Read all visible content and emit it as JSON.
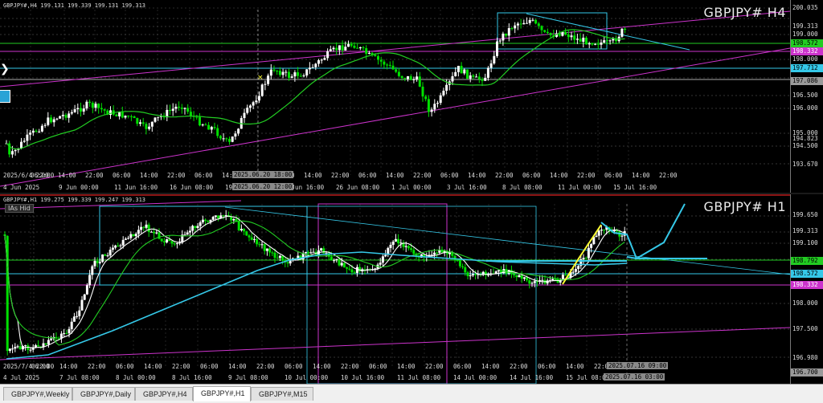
{
  "top": {
    "header": "GBPJPY#,H4  199.131 199.339 199.131 199.313",
    "symbol": "GBPJPY# H4",
    "prices": [
      "200.035",
      "199.313",
      "199.000",
      "198.572",
      "198.332",
      "198.000",
      "197.712",
      "197.086",
      "196.500",
      "196.000",
      "195.000",
      "194.823",
      "194.500",
      "193.670"
    ],
    "tags": {
      "green": "198.572",
      "magenta": "198.332",
      "cyan": "197.712",
      "gray": "197.086",
      "top": "200.035"
    },
    "times": [
      "2025/6/4 22:00",
      "06:00",
      "14:00",
      "22:00",
      "06:00",
      "14:00",
      "22:00",
      "06:00",
      "14:00",
      "22:00",
      "06:00",
      "14:00",
      "22:00",
      "06:00",
      "14:00",
      "22:00",
      "06:00",
      "14:00",
      "22:00",
      "06:00",
      "14:00",
      "22:00",
      "06:00",
      "14:00",
      "22:00"
    ],
    "dates": [
      "4 Jun 2025",
      "9 Jun 00:00",
      "11 Jun 16:00",
      "16 Jun 08:00",
      "19 Jun",
      "23 Jun 16:00",
      "26 Jun 08:00",
      "1 Jul 00:00",
      "3 Jul 16:00",
      "8 Jul 08:00",
      "11 Jul 00:00",
      "15 Jul 16:00"
    ],
    "cursor_times": [
      "2025.06.20 18:00",
      "2025.06.20 12:00"
    ]
  },
  "bottom": {
    "header": "GBPJPY#,H1  199.275 199.339 199.247 199.313",
    "symbol": "GBPJPY# H1",
    "ias": "IAs Hid",
    "prices": [
      "199.650",
      "199.313",
      "199.100",
      "198.792",
      "198.572",
      "198.332",
      "198.000",
      "197.500",
      "196.980",
      "196.700"
    ],
    "tags": {
      "green": "198.792",
      "cyan": "198.572",
      "magenta": "198.332",
      "gray": "196.700"
    },
    "times": [
      "2025/7/4 22:00",
      "06:00",
      "14:00",
      "22:00",
      "06:00",
      "14:00",
      "22:00",
      "06:00",
      "14:00",
      "22:00",
      "06:00",
      "14:00",
      "22:00",
      "06:00",
      "14:00",
      "22:00",
      "06:00",
      "14:00",
      "22:00",
      "06:00",
      "14:00",
      "22:00"
    ],
    "dates": [
      "4 Jul 2025",
      "7 Jul 08:00",
      "8 Jul 00:00",
      "8 Jul 16:00",
      "9 Jul 08:00",
      "10 Jul 00:00",
      "10 Jul 16:00",
      "11 Jul 08:00",
      "14 Jul 00:00",
      "14 Jul 16:00",
      "15 Jul 08:00"
    ],
    "cursor_times": [
      "2025.07.16 09:00",
      "2025.07.16 03:00"
    ]
  },
  "tabs": [
    "GBPJPY#,Weekly",
    "GBPJPY#,Daily",
    "GBPJPY#,H4",
    "GBPJPY#,H1",
    "GBPJPY#,M15"
  ],
  "active_tab": 3,
  "colors": {
    "bull": "#ffffff",
    "bear": "#00e000",
    "ma": "#22cc22",
    "cyan": "#35c8e8",
    "magenta": "#cc33cc",
    "yellow": "#ffff33",
    "red": "#e02020"
  }
}
